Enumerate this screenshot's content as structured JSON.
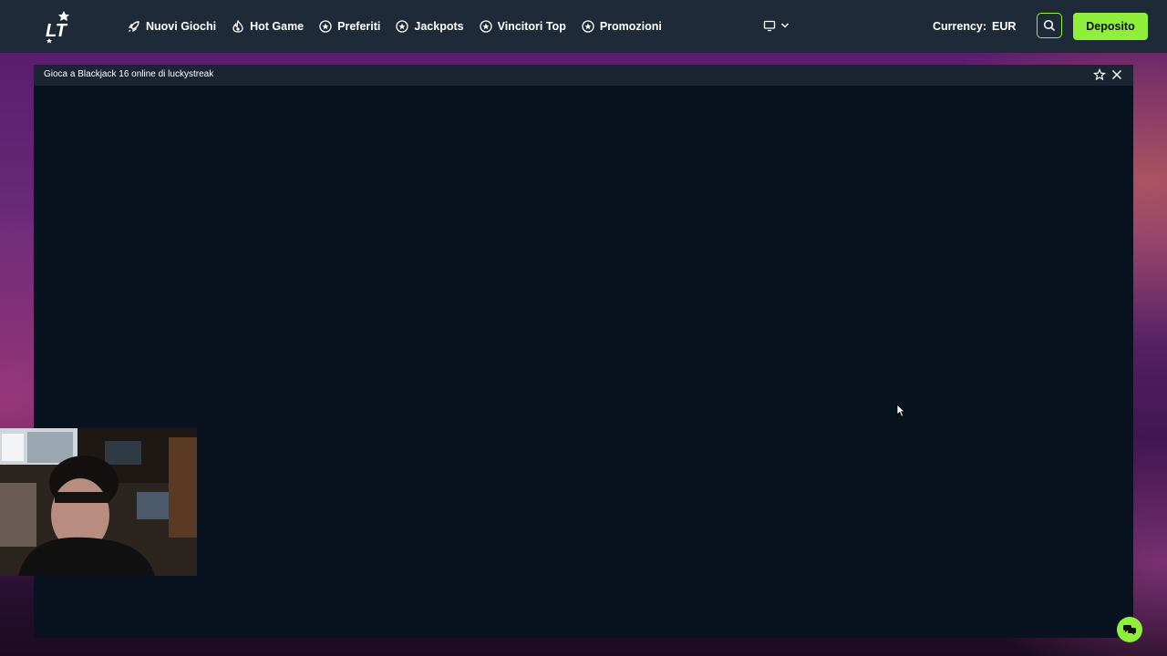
{
  "brand": {
    "logo_text": "LT",
    "accent_color": "#8ef03a"
  },
  "nav": {
    "items": [
      {
        "label": "Nuovi Giochi",
        "icon": "rocket-icon"
      },
      {
        "label": "Hot Game",
        "icon": "flame-icon"
      },
      {
        "label": "Preferiti",
        "icon": "star-circle-icon"
      },
      {
        "label": "Jackpots",
        "icon": "star-circle-icon"
      },
      {
        "label": "Vincitori Top",
        "icon": "star-circle-icon"
      },
      {
        "label": "Promozioni",
        "icon": "star-circle-icon"
      }
    ]
  },
  "header": {
    "device_icon": "monitor-icon",
    "currency_label": "Currency:",
    "currency_value": "EUR",
    "search_icon": "search-icon",
    "deposit_label": "Deposito"
  },
  "game": {
    "title": "Gioca a Blackjack 16 online di luckystreak",
    "favorite_icon": "star-outline-icon",
    "close_icon": "close-icon"
  },
  "widgets": {
    "chat_icon": "chat-bubbles-icon",
    "webcam": "streamer-webcam-overlay"
  }
}
